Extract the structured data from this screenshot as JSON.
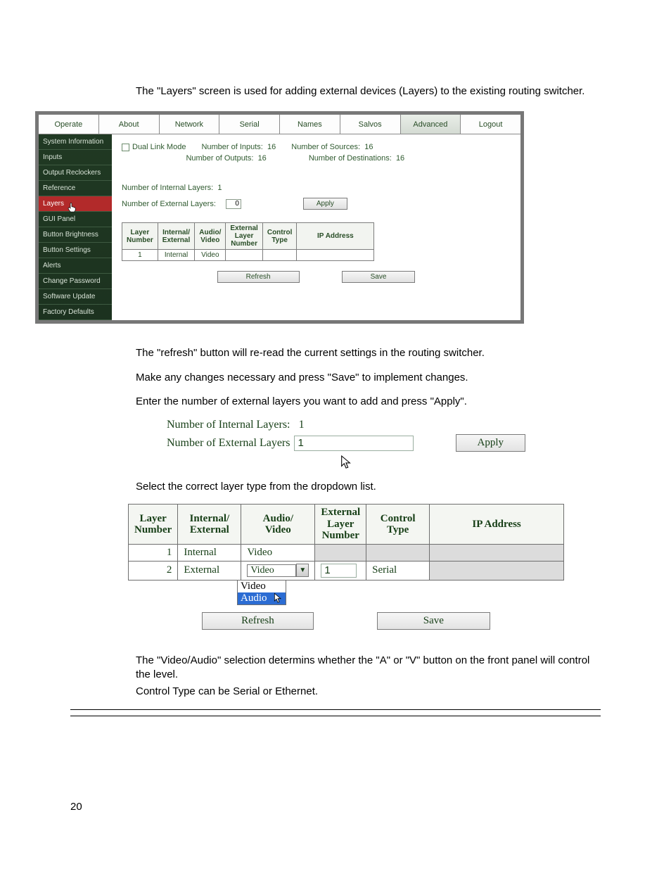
{
  "intro_paragraph": "The \"Layers\" screen is used for adding external devices (Layers) to the existing routing switcher.",
  "tabs": {
    "operate": "Operate",
    "about": "About",
    "network": "Network",
    "serial": "Serial",
    "names": "Names",
    "salvos": "Salvos",
    "advanced": "Advanced",
    "logout": "Logout"
  },
  "sidebar": {
    "system_information": "System Information",
    "inputs": "Inputs",
    "output_reclockers": "Output Reclockers",
    "reference": "Reference",
    "layers": "Layers",
    "gui_panel": "GUI Panel",
    "button_brightness": "Button Brightness",
    "button_settings": "Button Settings",
    "alerts": "Alerts",
    "change_password": "Change Password",
    "software_update": "Software Update",
    "factory_defaults": "Factory Defaults"
  },
  "content": {
    "dual_link_mode": "Dual Link Mode",
    "num_inputs_label": "Number of Inputs:",
    "num_inputs_value": "16",
    "num_outputs_label": "Number of Outputs:",
    "num_outputs_value": "16",
    "num_sources_label": "Number of Sources:",
    "num_sources_value": "16",
    "num_destinations_label": "Number of Destinations:",
    "num_destinations_value": "16",
    "num_internal_label": "Number of Internal Layers:",
    "num_internal_value": "1",
    "num_external_label": "Number of External Layers:",
    "num_external_value": "0",
    "apply": "Apply",
    "refresh": "Refresh",
    "save": "Save"
  },
  "app_table": {
    "headers": {
      "layer_number": "Layer\nNumber",
      "internal_external": "Internal/\nExternal",
      "audio_video": "Audio/\nVideo",
      "external_layer_number": "External\nLayer\nNumber",
      "control_type": "Control\nType",
      "ip_address": "IP Address"
    },
    "row1": {
      "layer_number": "1",
      "internal_external": "Internal",
      "audio_video": "Video"
    }
  },
  "after_app": {
    "p1": "The \"refresh\" button will re-read the current settings in the routing switcher.",
    "p2": "Make any changes necessary and press \"Save\" to implement changes.",
    "p3": "Enter the number of external layers you want to add and press \"Apply\"."
  },
  "closeup1": {
    "internal_label": "Number of Internal Layers:",
    "internal_value": "1",
    "external_label": "Number of External Layers",
    "external_value": "1",
    "apply": "Apply"
  },
  "after_closeup1": "Select the correct layer type from the dropdown list.",
  "table2": {
    "headers": {
      "layer_number": "Layer\nNumber",
      "internal_external": "Internal/\nExternal",
      "audio_video": "Audio/\nVideo",
      "external_layer_number": "External\nLayer\nNumber",
      "control_type": "Control\nType",
      "ip_address": "IP Address"
    },
    "row1": {
      "n": "1",
      "ie": "Internal",
      "av": "Video"
    },
    "row2": {
      "n": "2",
      "ie": "External",
      "av_select": "Video",
      "ext_num": "1",
      "ctrl": "Serial"
    },
    "dropdown": {
      "opt1": "Video",
      "opt2": "Audio"
    },
    "refresh": "Refresh",
    "save": "Save"
  },
  "closing": {
    "p1": "The \"Video/Audio\" selection determins whether the \"A\" or \"V\" button on the front panel will control the level.",
    "p2": "Control Type can be Serial or Ethernet."
  },
  "page_number": "20"
}
